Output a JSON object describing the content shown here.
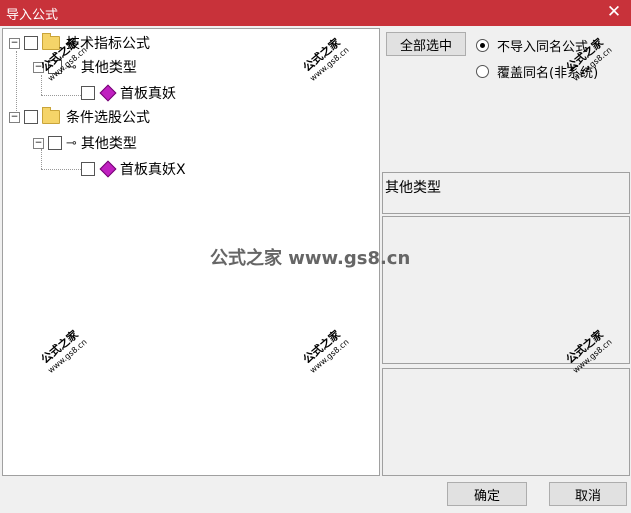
{
  "window": {
    "title": "导入公式",
    "close_glyph": "✕"
  },
  "tree": [
    {
      "label": "技术指标公式",
      "expander": "−",
      "icon": "folder-icon"
    },
    {
      "label": "其他类型",
      "expander": "−",
      "icon": "key-icon"
    },
    {
      "label": "首板真妖",
      "expander": "",
      "icon": "formula-icon"
    },
    {
      "label": "条件选股公式",
      "expander": "−",
      "icon": "folder-icon"
    },
    {
      "label": "其他类型",
      "expander": "−",
      "icon": "key-icon"
    },
    {
      "label": "首板真妖X",
      "expander": "",
      "icon": "formula-icon"
    }
  ],
  "buttons": {
    "select_all": "全部选中",
    "ok": "确定",
    "cancel": "取消"
  },
  "options": {
    "skip_same_name": "不导入同名公式",
    "overwrite_same_name": "覆盖同名(非系统)",
    "selected": "skip_same_name"
  },
  "info": {
    "category": "其他类型"
  },
  "watermark": {
    "cn": "公式之家",
    "url": "www.gs8.cn",
    "center": "公式之家 www.gs8.cn"
  }
}
